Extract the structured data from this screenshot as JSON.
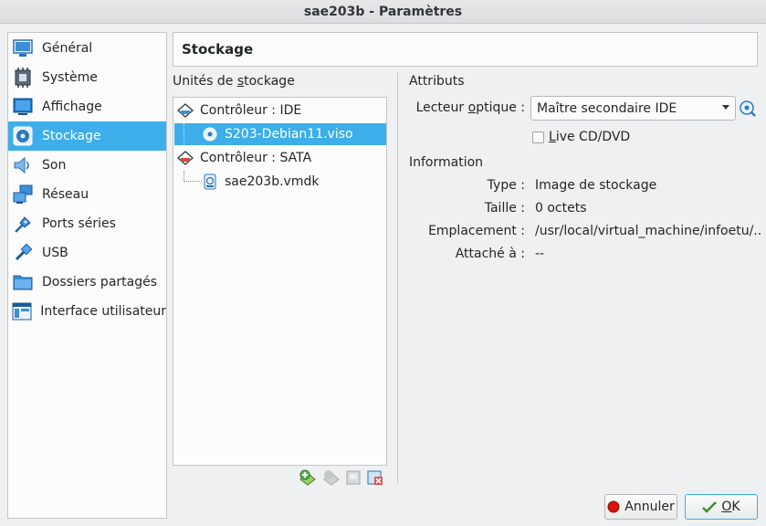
{
  "window": {
    "title": "sae203b - Paramètres"
  },
  "sidebar": {
    "items": [
      {
        "label": "Général",
        "icon": "general-icon"
      },
      {
        "label": "Système",
        "icon": "system-icon"
      },
      {
        "label": "Affichage",
        "icon": "display-icon"
      },
      {
        "label": "Stockage",
        "icon": "storage-icon",
        "selected": true
      },
      {
        "label": "Son",
        "icon": "audio-icon"
      },
      {
        "label": "Réseau",
        "icon": "network-icon"
      },
      {
        "label": "Ports séries",
        "icon": "serial-ports-icon"
      },
      {
        "label": "USB",
        "icon": "usb-icon"
      },
      {
        "label": "Dossiers partagés",
        "icon": "shared-folders-icon"
      },
      {
        "label": "Interface utilisateur",
        "icon": "user-interface-icon"
      }
    ]
  },
  "page": {
    "title": "Stockage"
  },
  "storage": {
    "section_label_pre": "Unités de ",
    "section_label_key": "s",
    "section_label_post": "tockage",
    "tree": [
      {
        "label": "Contrôleur : IDE",
        "type": "controller-ide"
      },
      {
        "label": "S203-Debian11.viso",
        "type": "optical",
        "selected": true
      },
      {
        "label": "Contrôleur : SATA",
        "type": "controller-sata"
      },
      {
        "label": "sae203b.vmdk",
        "type": "disk"
      }
    ]
  },
  "attributes": {
    "section_label": "Attributs",
    "drive_label_pre": "Lecteur ",
    "drive_label_key": "o",
    "drive_label_post": "ptique :",
    "drive_value": "Maître secondaire IDE",
    "live_label_key": "L",
    "live_label_post": "ive CD/DVD",
    "live_checked": false
  },
  "information": {
    "section_label": "Information",
    "rows": [
      {
        "label": "Type :",
        "value": "Image de stockage"
      },
      {
        "label": "Taille :",
        "value": "0 octets"
      },
      {
        "label": "Emplacement :",
        "value": "/usr/local/virtual_machine/infoetu/..."
      },
      {
        "label": "Attaché à :",
        "value": "--"
      }
    ]
  },
  "buttons": {
    "cancel_label": "Annuler",
    "ok_key": "O",
    "ok_post": "K"
  },
  "colors": {
    "selection": "#3daee9"
  }
}
